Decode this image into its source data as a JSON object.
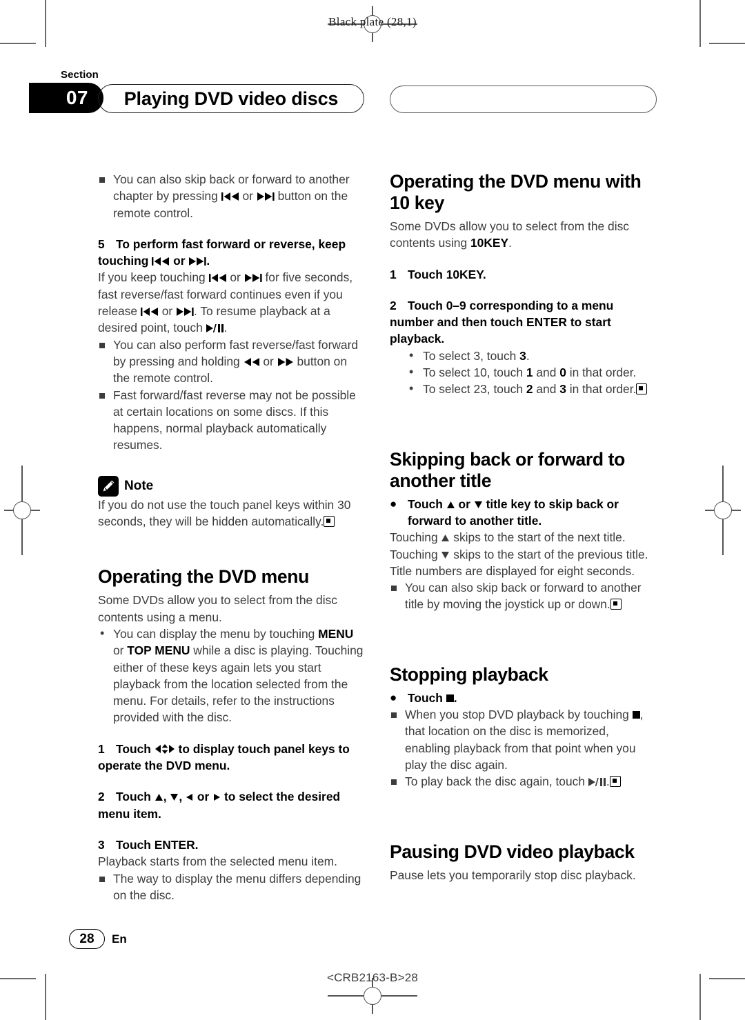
{
  "page": {
    "plate_note": "Black plate (28,1)",
    "section_word": "Section",
    "section_number": "07",
    "section_title": "Playing DVD video discs",
    "page_number": "28",
    "language": "En",
    "doc_id": "<CRB2163-B>28"
  },
  "left_column": {
    "bullet_skip_chapter": {
      "t1": "You can also skip back or forward to another chapter by pressing ",
      "t2": " or ",
      "t3": " button on the remote control."
    },
    "step5": {
      "num": "5",
      "title_a": "To perform fast forward or reverse, keep touching ",
      "title_b": " or ",
      "title_c": ".",
      "body_a": "If you keep touching ",
      "body_b": " or ",
      "body_c": " for five seconds, fast reverse/fast forward continues even if you release ",
      "body_d": " or ",
      "body_e": ". To resume playback at a desired point, touch ",
      "body_f": "."
    },
    "bullet_fast": {
      "t1": "You can also perform fast reverse/fast forward by pressing and holding ",
      "t2": " or ",
      "t3": " button on the remote control."
    },
    "bullet_fast_limit": "Fast forward/fast reverse may not be possible at certain locations on some discs. If this happens, normal playback automatically resumes.",
    "note": {
      "label": "Note",
      "text": "If you do not use the touch panel keys within 30 seconds, they will be hidden automatically."
    },
    "dvd_menu": {
      "heading": "Operating the DVD menu",
      "intro": "Some DVDs allow you to select from the disc contents using a menu.",
      "bullet_a": "You can display the menu by touching ",
      "bullet_menu": "MENU",
      "bullet_b": " or ",
      "bullet_topmenu": "TOP MENU",
      "bullet_c": " while a disc is playing. Touching either of these keys again lets you start playback from the location selected from the menu. For details, refer to the instructions provided with the disc.",
      "step1": {
        "num": "1",
        "text_a": "Touch ",
        "text_b": " to display touch panel keys to operate the DVD menu."
      },
      "step2": {
        "num": "2",
        "text_a": "Touch ",
        "text_b": ", ",
        "text_c": ", ",
        "text_d": " or ",
        "text_e": " to select the desired menu item."
      },
      "step3": {
        "num": "3",
        "text": "Touch ENTER.",
        "body": "Playback starts from the selected menu item."
      },
      "bullet_way": "The way to display the menu differs depending on the disc."
    }
  },
  "right_column": {
    "ten_key": {
      "heading": "Operating the DVD menu with 10 key",
      "intro_a": "Some DVDs allow you to select from the disc contents using ",
      "intro_key": "10KEY",
      "intro_b": ".",
      "step1": {
        "num": "1",
        "text": "Touch 10KEY."
      },
      "step2": {
        "num": "2",
        "text": "Touch 0–9 corresponding to a menu number and then touch ENTER to start playback."
      },
      "examples": [
        {
          "pre": "To select 3, touch ",
          "k1": "3",
          "mid": "",
          "k2": "",
          "post": "."
        },
        {
          "pre": "To select 10, touch ",
          "k1": "1",
          "mid": " and ",
          "k2": "0",
          "post": " in that order."
        },
        {
          "pre": "To select 23, touch ",
          "k1": "2",
          "mid": " and ",
          "k2": "3",
          "post": " in that order."
        }
      ]
    },
    "skipping": {
      "heading": "Skipping back or forward to another title",
      "action_a": "Touch ",
      "action_b": " or ",
      "action_c": " title key to skip back or forward to another title.",
      "body_a": "Touching ",
      "body_b": " skips to the start of the next title.",
      "body_c": "Touching ",
      "body_d": " skips to the start of the previous title.",
      "body_e": "Title numbers are displayed for eight seconds.",
      "bullet": "You can also skip back or forward to another title by moving the joystick up or down."
    },
    "stopping": {
      "heading": "Stopping playback",
      "action_a": "Touch ",
      "action_b": ".",
      "bullet1_a": "When you stop DVD playback by touching ",
      "bullet1_b": ", that location on the disc is memorized, enabling playback from that point when you play the disc again.",
      "bullet2_a": "To play back the disc again, touch ",
      "bullet2_b": "."
    },
    "pausing": {
      "heading": "Pausing DVD video playback",
      "intro": "Pause lets you temporarily stop disc playback."
    }
  },
  "icons": {
    "skip_back": "skip-back-icon",
    "skip_forward": "skip-forward-icon",
    "fast_reverse": "fast-reverse-icon",
    "fast_forward": "fast-forward-icon",
    "play_pause": "play-pause-icon",
    "stop": "stop-icon",
    "up_triangle": "triangle-up-icon",
    "down_triangle": "triangle-down-icon",
    "left_triangle": "triangle-left-icon",
    "right_triangle": "triangle-right-icon",
    "joystick": "joystick-icon",
    "note_pencil": "pencil-icon",
    "end_mark": "end-of-section-icon"
  },
  "colors": {
    "text": "#3c3c3c",
    "heading": "#000000",
    "marks": "#555555"
  }
}
